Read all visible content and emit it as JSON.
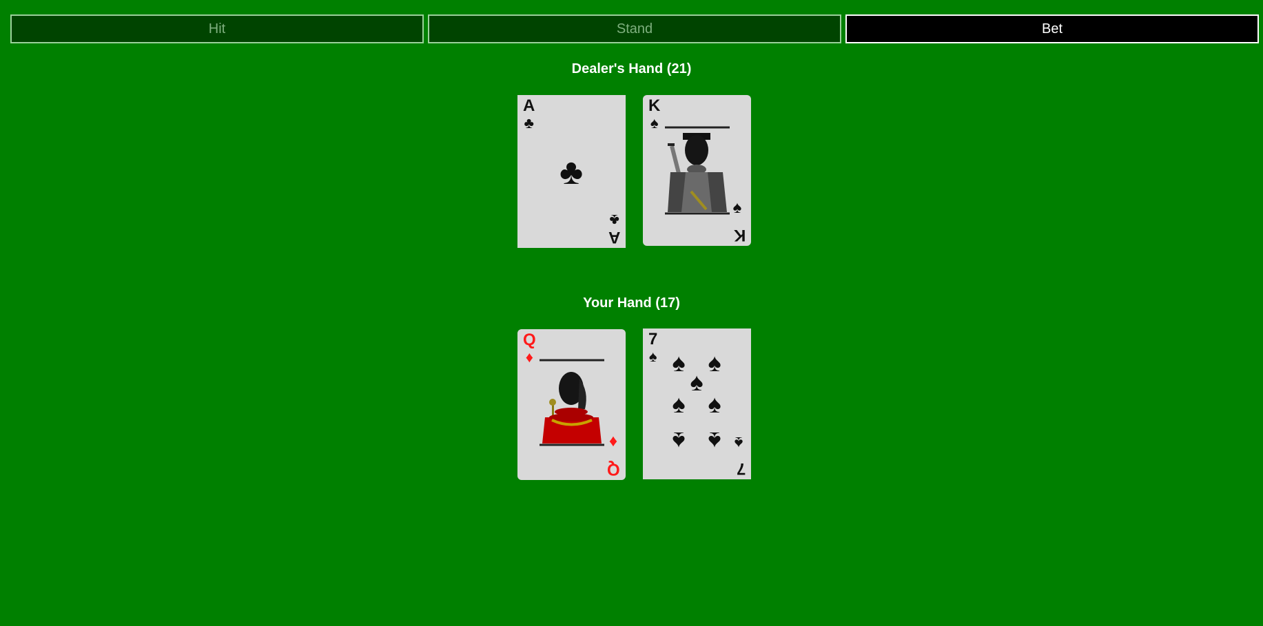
{
  "controls": {
    "hit_label": "Hit",
    "stand_label": "Stand",
    "bet_label": "Bet"
  },
  "dealer": {
    "title": "Dealer's Hand (21)",
    "cards": [
      {
        "rank": "A",
        "suit": "♣",
        "suit_name": "clubs",
        "color": "black"
      },
      {
        "rank": "K",
        "suit": "♠",
        "suit_name": "spades",
        "color": "black"
      }
    ]
  },
  "player": {
    "title": "Your Hand (17)",
    "cards": [
      {
        "rank": "Q",
        "suit": "♦",
        "suit_name": "diamonds",
        "color": "red"
      },
      {
        "rank": "7",
        "suit": "♠",
        "suit_name": "spades",
        "color": "black"
      }
    ]
  },
  "colors": {
    "table": "#008000",
    "card_face": "#d9d9d9",
    "red_suit": "#ff1a1a",
    "active_button": "#000000"
  },
  "icons": {
    "king": "king-of-spades-figure-icon",
    "queen": "queen-of-diamonds-figure-icon"
  }
}
